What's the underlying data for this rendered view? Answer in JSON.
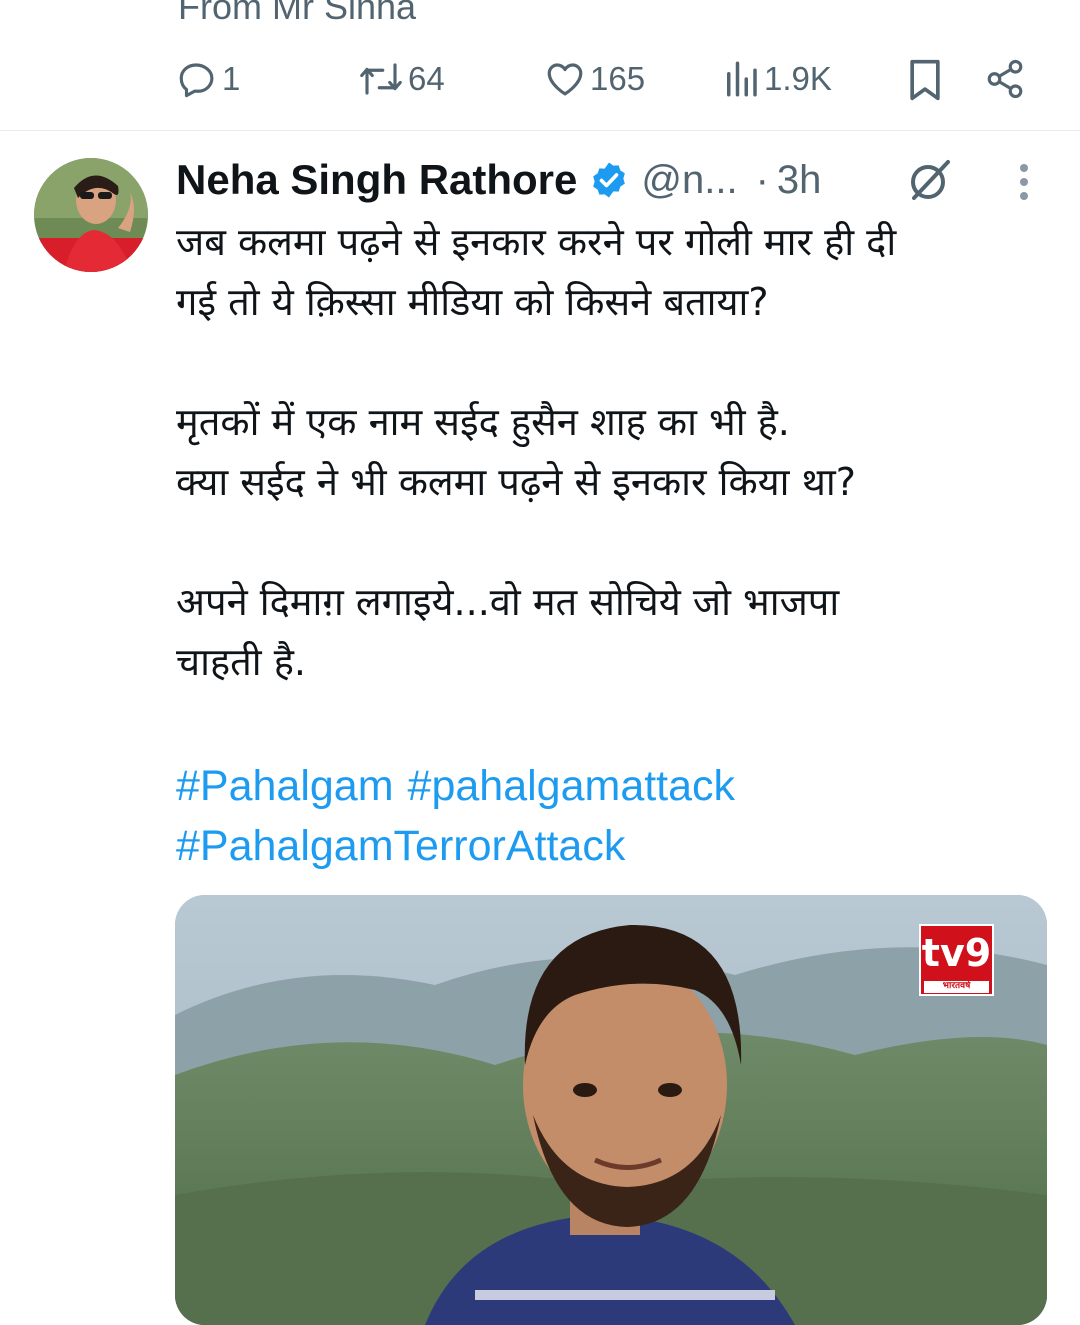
{
  "previous_tweet": {
    "text_partial": "From Mr Sinha",
    "actions": {
      "replies": "1",
      "retweets": "64",
      "likes": "165",
      "views": "1.9K"
    }
  },
  "tweet": {
    "author_name": "Neha Singh Rathore",
    "handle": "@n...",
    "separator": "·",
    "time": "3h",
    "paragraphs": [
      [
        "जब कलमा पढ़ने से इनकार करने पर गोली मार ही दी",
        "गई तो ये क़िस्सा मीडिया को किसने बताया?"
      ],
      [
        "मृतकों में एक नाम सईद हुसैन शाह का भी है.",
        "क्या सईद ने भी कलमा पढ़ने से इनकार किया था?"
      ],
      [
        "अपने दिमाग़ लगाइये...वो मत सोचिये जो भाजपा",
        "चाहती है."
      ]
    ],
    "hashtags": [
      "#Pahalgam",
      "#pahalgamattack",
      "#PahalgamTerrorAttack"
    ],
    "media": {
      "logo_text": "tv9",
      "logo_subtext": "भारतवर्ष"
    }
  },
  "colors": {
    "accent": "#1d9bf0",
    "secondary_text": "#536471",
    "primary_text": "#0f1419",
    "divider": "#e6ecf0"
  },
  "icons": [
    "reply-icon",
    "retweet-icon",
    "like-icon",
    "views-icon",
    "bookmark-icon",
    "share-icon",
    "verified-badge-icon",
    "grok-icon",
    "more-options-icon"
  ]
}
